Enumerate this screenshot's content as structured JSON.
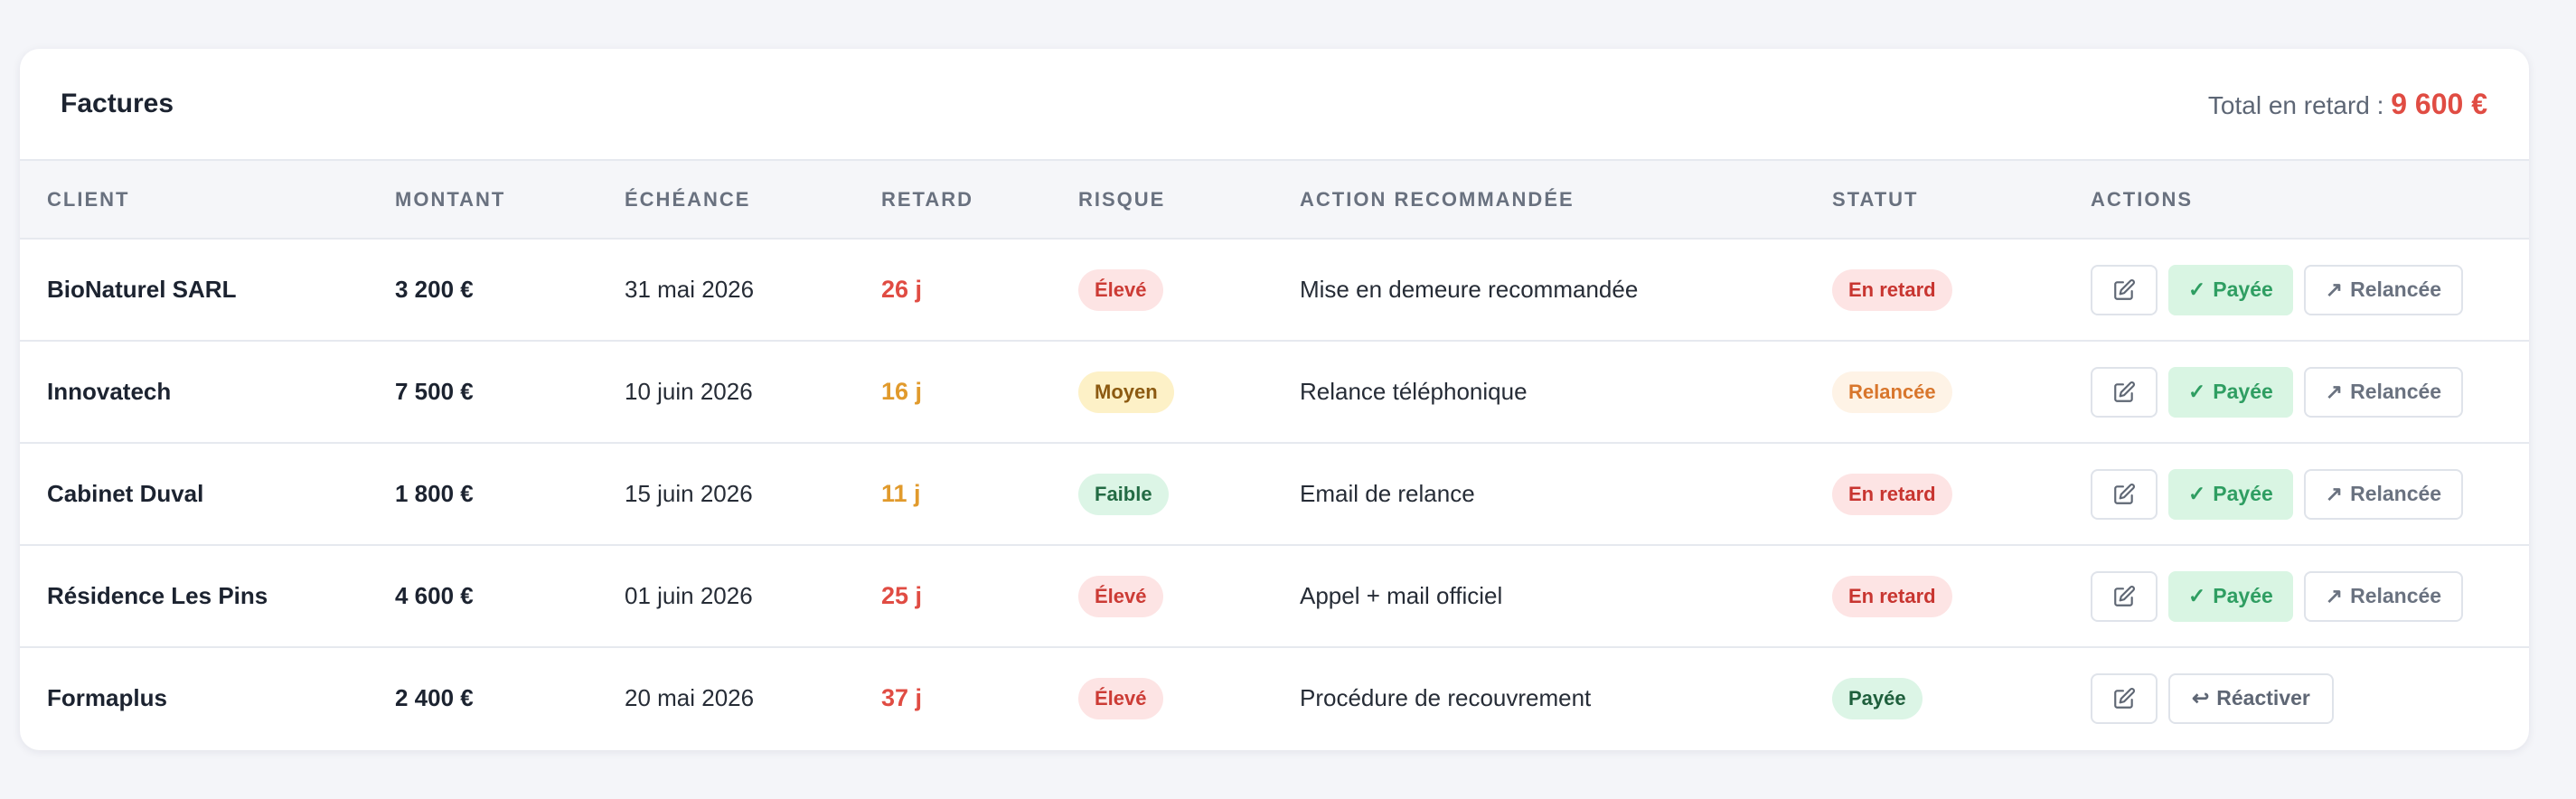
{
  "header": {
    "title": "Factures",
    "total_label": "Total en retard : ",
    "total_value": "9 600 €"
  },
  "columns": [
    "CLIENT",
    "MONTANT",
    "ÉCHÉANCE",
    "RETARD",
    "RISQUE",
    "ACTION RECOMMANDÉE",
    "STATUT",
    "ACTIONS"
  ],
  "rows": [
    {
      "client": "BioNaturel SARL",
      "amount": "3 200 €",
      "due": "31 mai 2026",
      "delay": "26 j",
      "risk": "Élevé",
      "action": "Mise en demeure recommandée",
      "status": "En retard"
    },
    {
      "client": "Innovatech",
      "amount": "7 500 €",
      "due": "10 juin 2026",
      "delay": "16 j",
      "risk": "Moyen",
      "action": "Relance téléphonique",
      "status": "Relancée"
    },
    {
      "client": "Cabinet Duval",
      "amount": "1 800 €",
      "due": "15 juin 2026",
      "delay": "11 j",
      "risk": "Faible",
      "action": "Email de relance",
      "status": "En retard"
    },
    {
      "client": "Résidence Les Pins",
      "amount": "4 600 €",
      "due": "01 juin 2026",
      "delay": "25 j",
      "risk": "Élevé",
      "action": "Appel + mail officiel",
      "status": "En retard"
    },
    {
      "client": "Formaplus",
      "amount": "2 400 €",
      "due": "20 mai 2026",
      "delay": "37 j",
      "risk": "Élevé",
      "action": "Procédure de recouvrement",
      "status": "Payée"
    }
  ],
  "buttons": {
    "paid_icon": "✓",
    "paid_label": "Payée",
    "relance_icon": "↗",
    "relance_label": "Relancée",
    "reactivate_icon": "↩",
    "reactivate_label": "Réactiver",
    "edit_icon": "edit-icon"
  },
  "colors": {
    "danger": "#e04c43",
    "warning": "#e19a2c",
    "success": "#2f9e62"
  }
}
